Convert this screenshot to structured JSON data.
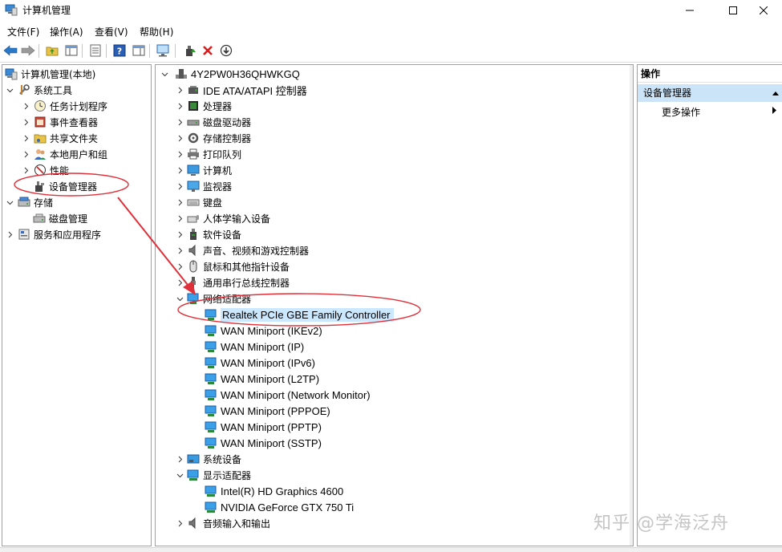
{
  "window": {
    "title": "计算机管理"
  },
  "menu": [
    "文件(F)",
    "操作(A)",
    "查看(V)",
    "帮助(H)"
  ],
  "left_tree": {
    "root": "计算机管理(本地)",
    "system_tools": "系统工具",
    "task_scheduler": "任务计划程序",
    "event_viewer": "事件查看器",
    "shared_folders": "共享文件夹",
    "local_users": "本地用户和组",
    "performance": "性能",
    "device_manager": "设备管理器",
    "storage": "存储",
    "disk_management": "磁盘管理",
    "services": "服务和应用程序"
  },
  "device_tree": {
    "computer_name": "4Y2PW0H36QHWKGQ",
    "categories": [
      "IDE ATA/ATAPI 控制器",
      "处理器",
      "磁盘驱动器",
      "存储控制器",
      "打印队列",
      "计算机",
      "监视器",
      "键盘",
      "人体学输入设备",
      "软件设备",
      "声音、视频和游戏控制器",
      "鼠标和其他指针设备",
      "通用串行总线控制器",
      "网络适配器"
    ],
    "network_adapters": [
      "Realtek PCIe GBE Family Controller",
      "WAN Miniport (IKEv2)",
      "WAN Miniport (IP)",
      "WAN Miniport (IPv6)",
      "WAN Miniport (L2TP)",
      "WAN Miniport (Network Monitor)",
      "WAN Miniport (PPPOE)",
      "WAN Miniport (PPTP)",
      "WAN Miniport (SSTP)"
    ],
    "system_devices": "系统设备",
    "display_adapters": "显示适配器",
    "display_items": [
      "Intel(R) HD Graphics 4600",
      "NVIDIA GeForce GTX 750 Ti"
    ],
    "audio_io": "音频输入和输出"
  },
  "actions": {
    "header": "操作",
    "section": "设备管理器",
    "more": "更多操作"
  },
  "watermark": "知乎 @学海泛舟",
  "colors": {
    "selection": "#cce8ff",
    "annotation": "#e0303a",
    "action_section": "#cce4f7"
  }
}
